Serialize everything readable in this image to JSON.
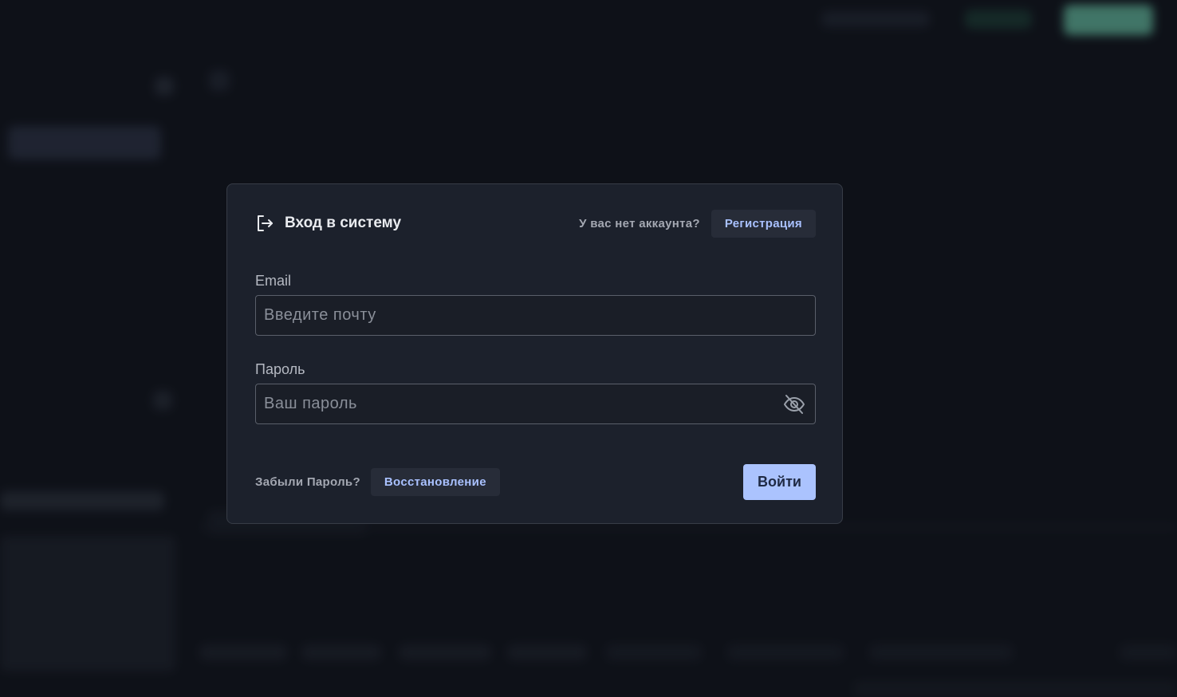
{
  "modal": {
    "title": "Вход в систему",
    "icon": "login-icon",
    "no_account_text": "У вас нет аккаунта?",
    "register_label": "Регистрация"
  },
  "form": {
    "email": {
      "label": "Email",
      "placeholder": "Введите почту",
      "value": ""
    },
    "password": {
      "label": "Пароль",
      "placeholder": "Ваш пароль",
      "value": "",
      "toggle_icon": "eye-off-icon"
    }
  },
  "footer": {
    "forgot_text": "Забыли Пароль?",
    "recover_label": "Восстановление",
    "submit_label": "Войти"
  },
  "colors": {
    "accent": "#abc3fe",
    "link": "#a9c1ff",
    "modal_bg": "#1c212c",
    "page_bg": "#12151d"
  }
}
